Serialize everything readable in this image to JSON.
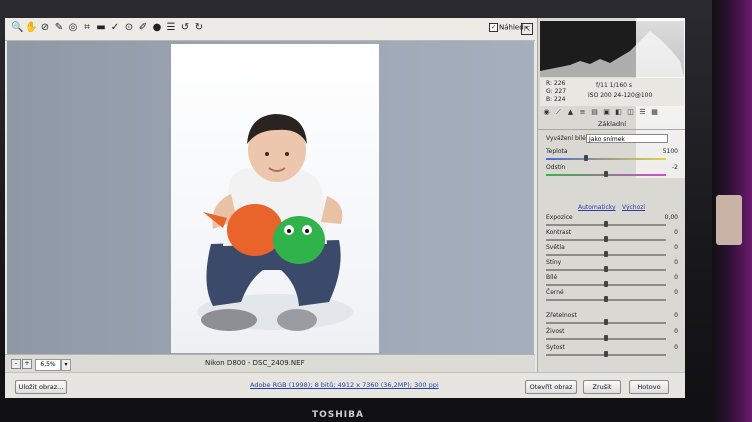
{
  "window": {
    "preview_label": "Náhled",
    "preview_checked": true
  },
  "toolbar": {
    "tools": [
      {
        "icon": "zoom-tool-icon",
        "glyph": "🔍"
      },
      {
        "icon": "hand-tool-icon",
        "glyph": "✋"
      },
      {
        "icon": "white-balance-icon",
        "glyph": "⊘"
      },
      {
        "icon": "color-sampler-icon",
        "glyph": "✎"
      },
      {
        "icon": "target-adjust-icon",
        "glyph": "◎"
      },
      {
        "icon": "crop-icon",
        "glyph": "⌗"
      },
      {
        "icon": "straighten-icon",
        "glyph": "▬"
      },
      {
        "icon": "spot-removal-icon",
        "glyph": "✓"
      },
      {
        "icon": "red-eye-icon",
        "glyph": "⊙"
      },
      {
        "icon": "brush-icon",
        "glyph": "✐"
      },
      {
        "icon": "graduated-filter-icon",
        "glyph": "●"
      },
      {
        "icon": "list-icon",
        "glyph": "☰"
      },
      {
        "icon": "rotate-left-icon",
        "glyph": "↺"
      },
      {
        "icon": "rotate-right-icon",
        "glyph": "↻"
      }
    ]
  },
  "canvas": {
    "zoom_value": "6,5%",
    "filename": "Nikon D800 - DSC_2409.NEF"
  },
  "bottom_bar": {
    "save_label": "Uložit obraz...",
    "workflow_text": "Adobe RGB (1998); 8 bitů; 4912 x 7360 (36,2MP); 300 ppi",
    "open_label": "Otevřít obraz",
    "cancel_label": "Zrušit",
    "done_label": "Hotovo"
  },
  "info": {
    "r": "R:  226",
    "g": "G:  227",
    "b": "B:  224",
    "aperture_shutter": "f/11   1/160 s",
    "iso_lens": "ISO 200   24-120@100"
  },
  "panel": {
    "section_title": "Základní",
    "wb_label": "Vyvážení bílé:",
    "wb_value": "Jako snímek",
    "temp_label": "Teplota",
    "temp_value": "5100",
    "tint_label": "Odstín",
    "tint_value": "-2",
    "auto_label": "Automaticky",
    "default_label": "Výchozí",
    "sliders": [
      {
        "label": "Expozice",
        "value": "0,00",
        "pos": 0.5
      },
      {
        "label": "Kontrast",
        "value": "0",
        "pos": 0.5
      },
      {
        "label": "Světla",
        "value": "0",
        "pos": 0.5
      },
      {
        "label": "Stíny",
        "value": "0",
        "pos": 0.5
      },
      {
        "label": "Bílé",
        "value": "0",
        "pos": 0.5
      },
      {
        "label": "Černé",
        "value": "0",
        "pos": 0.5
      }
    ],
    "sliders2": [
      {
        "label": "Zřetelnost",
        "value": "0",
        "pos": 0.5
      },
      {
        "label": "Živost",
        "value": "0",
        "pos": 0.5
      },
      {
        "label": "Sytost",
        "value": "0",
        "pos": 0.5
      }
    ]
  },
  "monitor": {
    "brand": "TOSHIBA"
  }
}
